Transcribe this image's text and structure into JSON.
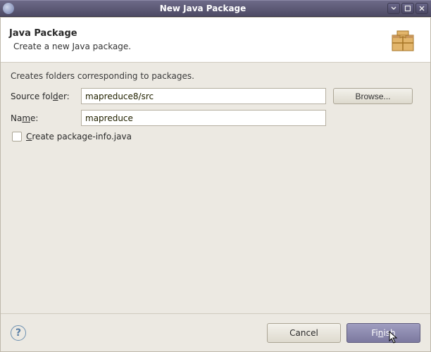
{
  "window": {
    "title": "New Java Package"
  },
  "header": {
    "title": "Java Package",
    "description": "Create a new Java package."
  },
  "body": {
    "hint": "Creates folders corresponding to packages.",
    "source_label_pre": "Source fol",
    "source_label_mn": "d",
    "source_label_post": "er:",
    "source_value": "mapreduce8/src",
    "browse_label": "Browse...",
    "name_label_pre": "Na",
    "name_label_mn": "m",
    "name_label_post": "e:",
    "name_value": "mapreduce",
    "checkbox_pre": "",
    "checkbox_mn": "C",
    "checkbox_post": "reate package-info.java",
    "checkbox_checked": false
  },
  "footer": {
    "help": "?",
    "cancel": "Cancel",
    "finish_pre": "Fi",
    "finish_mn": "n",
    "finish_post": "ish"
  }
}
